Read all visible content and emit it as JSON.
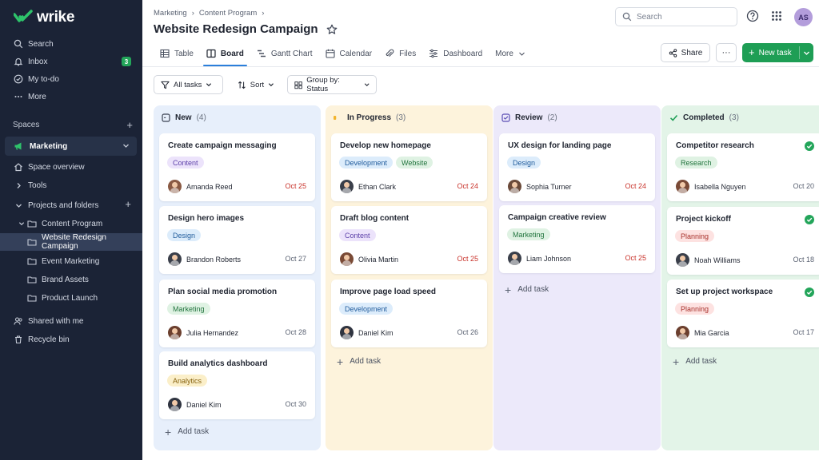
{
  "app": {
    "name": "wrike"
  },
  "colors": {
    "sidebar": "#1b2336",
    "accent": "#1e9e55",
    "tab_underline": "#2b7fdb",
    "overdue": "#c9332b"
  },
  "sidebar": {
    "top_items": [
      {
        "label": "Search",
        "icon": "search-icon"
      },
      {
        "label": "Inbox",
        "icon": "bell-icon",
        "badge": "3"
      },
      {
        "label": "My to-do",
        "icon": "check-circle-icon"
      },
      {
        "label": "More",
        "icon": "ellipsis-icon"
      }
    ],
    "spaces_label": "Spaces",
    "space": {
      "label": "Marketing",
      "icon": "megaphone-icon"
    },
    "tree": [
      {
        "label": "Space overview",
        "icon": "home-icon"
      },
      {
        "label": "Tools",
        "icon": "chevron-right-icon"
      },
      {
        "label": "Projects and folders",
        "icon": "chevron-down-icon"
      },
      {
        "label": "Content Program",
        "icon": "folder-icon"
      },
      {
        "label": "Website Redesign Campaign",
        "icon": "folder-icon",
        "active": true
      },
      {
        "label": "Event Marketing",
        "icon": "folder-icon"
      },
      {
        "label": "Brand Assets",
        "icon": "folder-icon"
      },
      {
        "label": "Product Launch",
        "icon": "folder-icon"
      }
    ],
    "bottom_items": [
      {
        "label": "Shared with me",
        "icon": "users-icon"
      },
      {
        "label": "Recycle bin",
        "icon": "trash-icon"
      }
    ]
  },
  "header": {
    "breadcrumb": [
      "Marketing",
      "Content Program"
    ],
    "title": "Website Redesign Campaign",
    "search_placeholder": "Search",
    "avatar_initials": "AS"
  },
  "tabs": [
    {
      "label": "Table",
      "icon": "table-icon"
    },
    {
      "label": "Board",
      "icon": "board-icon",
      "active": true
    },
    {
      "label": "Gantt Chart",
      "icon": "gantt-icon"
    },
    {
      "label": "Calendar",
      "icon": "calendar-icon"
    },
    {
      "label": "Files",
      "icon": "paperclip-icon"
    },
    {
      "label": "Dashboard",
      "icon": "dashboard-icon"
    },
    {
      "label": "More",
      "icon": "chevron-down-icon"
    }
  ],
  "actions": {
    "share": "Share",
    "more": "···",
    "new_task": "New task"
  },
  "filters": {
    "all_tasks": "All tasks",
    "sort": "Sort",
    "group_by": "Group by: Status"
  },
  "board": {
    "add_task": "Add task",
    "columns": [
      {
        "name": "New",
        "count": "(4)",
        "bg": "#e7effb",
        "icon": "status-new-icon",
        "cards": [
          {
            "title": "Create campaign messaging",
            "tags": [
              {
                "label": "Content",
                "bg": "#ece3fb",
                "fg": "#5b3fa8"
              }
            ],
            "assignee": "Amanda Reed",
            "due": "Oct 25",
            "overdue": true,
            "face": "#8a5a44"
          },
          {
            "title": "Design hero images",
            "tags": [
              {
                "label": "Design",
                "bg": "#dcecfb",
                "fg": "#215c9c"
              }
            ],
            "assignee": "Brandon Roberts",
            "due": "Oct 27",
            "overdue": false,
            "face": "#3a3f4a"
          },
          {
            "title": "Plan social media promotion",
            "tags": [
              {
                "label": "Marketing",
                "bg": "#dff2e3",
                "fg": "#22743e"
              }
            ],
            "assignee": "Julia Hernandez",
            "due": "Oct 28",
            "overdue": false,
            "face": "#6b3f2e"
          },
          {
            "title": "Build analytics dashboard",
            "tags": [
              {
                "label": "Analytics",
                "bg": "#fbefc9",
                "fg": "#87620f"
              }
            ],
            "assignee": "Daniel Kim",
            "due": "Oct 30",
            "overdue": false,
            "face": "#2f3440"
          }
        ]
      },
      {
        "name": "In Progress",
        "count": "(3)",
        "bg": "#fdf3dc",
        "icon": "status-progress-icon",
        "cards": [
          {
            "title": "Develop new homepage",
            "tags": [
              {
                "label": "Development",
                "bg": "#dcecfb",
                "fg": "#215c9c"
              },
              {
                "label": "Website",
                "bg": "#dff2e3",
                "fg": "#22743e"
              }
            ],
            "assignee": "Ethan Clark",
            "due": "Oct 24",
            "overdue": true,
            "face": "#3a3f4a"
          },
          {
            "title": "Draft blog content",
            "tags": [
              {
                "label": "Content",
                "bg": "#ece3fb",
                "fg": "#5b3fa8"
              }
            ],
            "assignee": "Olivia Martin",
            "due": "Oct 25",
            "overdue": true,
            "face": "#7a4a36"
          },
          {
            "title": "Improve page load speed",
            "tags": [
              {
                "label": "Development",
                "bg": "#dcecfb",
                "fg": "#215c9c"
              }
            ],
            "assignee": "Daniel Kim",
            "due": "Oct 26",
            "overdue": false,
            "face": "#2f3440"
          }
        ]
      },
      {
        "name": "Review",
        "count": "(2)",
        "bg": "#ece9fa",
        "icon": "status-review-icon",
        "cards": [
          {
            "title": "UX design for landing page",
            "tags": [
              {
                "label": "Design",
                "bg": "#dcecfb",
                "fg": "#215c9c"
              }
            ],
            "assignee": "Sophia Turner",
            "due": "Oct 24",
            "overdue": true,
            "face": "#6b4a3a"
          },
          {
            "title": "Campaign creative review",
            "tags": [
              {
                "label": "Marketing",
                "bg": "#dff2e3",
                "fg": "#22743e"
              }
            ],
            "assignee": "Liam Johnson",
            "due": "Oct 25",
            "overdue": true,
            "face": "#3a3f4a"
          }
        ]
      },
      {
        "name": "Completed",
        "count": "(3)",
        "bg": "#e3f4e8",
        "icon": "status-completed-icon",
        "cards": [
          {
            "title": "Competitor research",
            "tags": [
              {
                "label": "Research",
                "bg": "#dff2e3",
                "fg": "#22743e"
              }
            ],
            "assignee": "Isabella Nguyen",
            "due": "Oct 20",
            "overdue": false,
            "done": true,
            "face": "#7a4a36"
          },
          {
            "title": "Project kickoff",
            "tags": [
              {
                "label": "Planning",
                "bg": "#fde2e1",
                "fg": "#a8322c"
              }
            ],
            "assignee": "Noah Williams",
            "due": "Oct 18",
            "overdue": false,
            "done": true,
            "face": "#3a3f4a"
          },
          {
            "title": "Set up project workspace",
            "tags": [
              {
                "label": "Planning",
                "bg": "#fde2e1",
                "fg": "#a8322c"
              }
            ],
            "assignee": "Mia Garcia",
            "due": "Oct 17",
            "overdue": false,
            "done": true,
            "face": "#6b3f2e"
          }
        ]
      }
    ]
  }
}
